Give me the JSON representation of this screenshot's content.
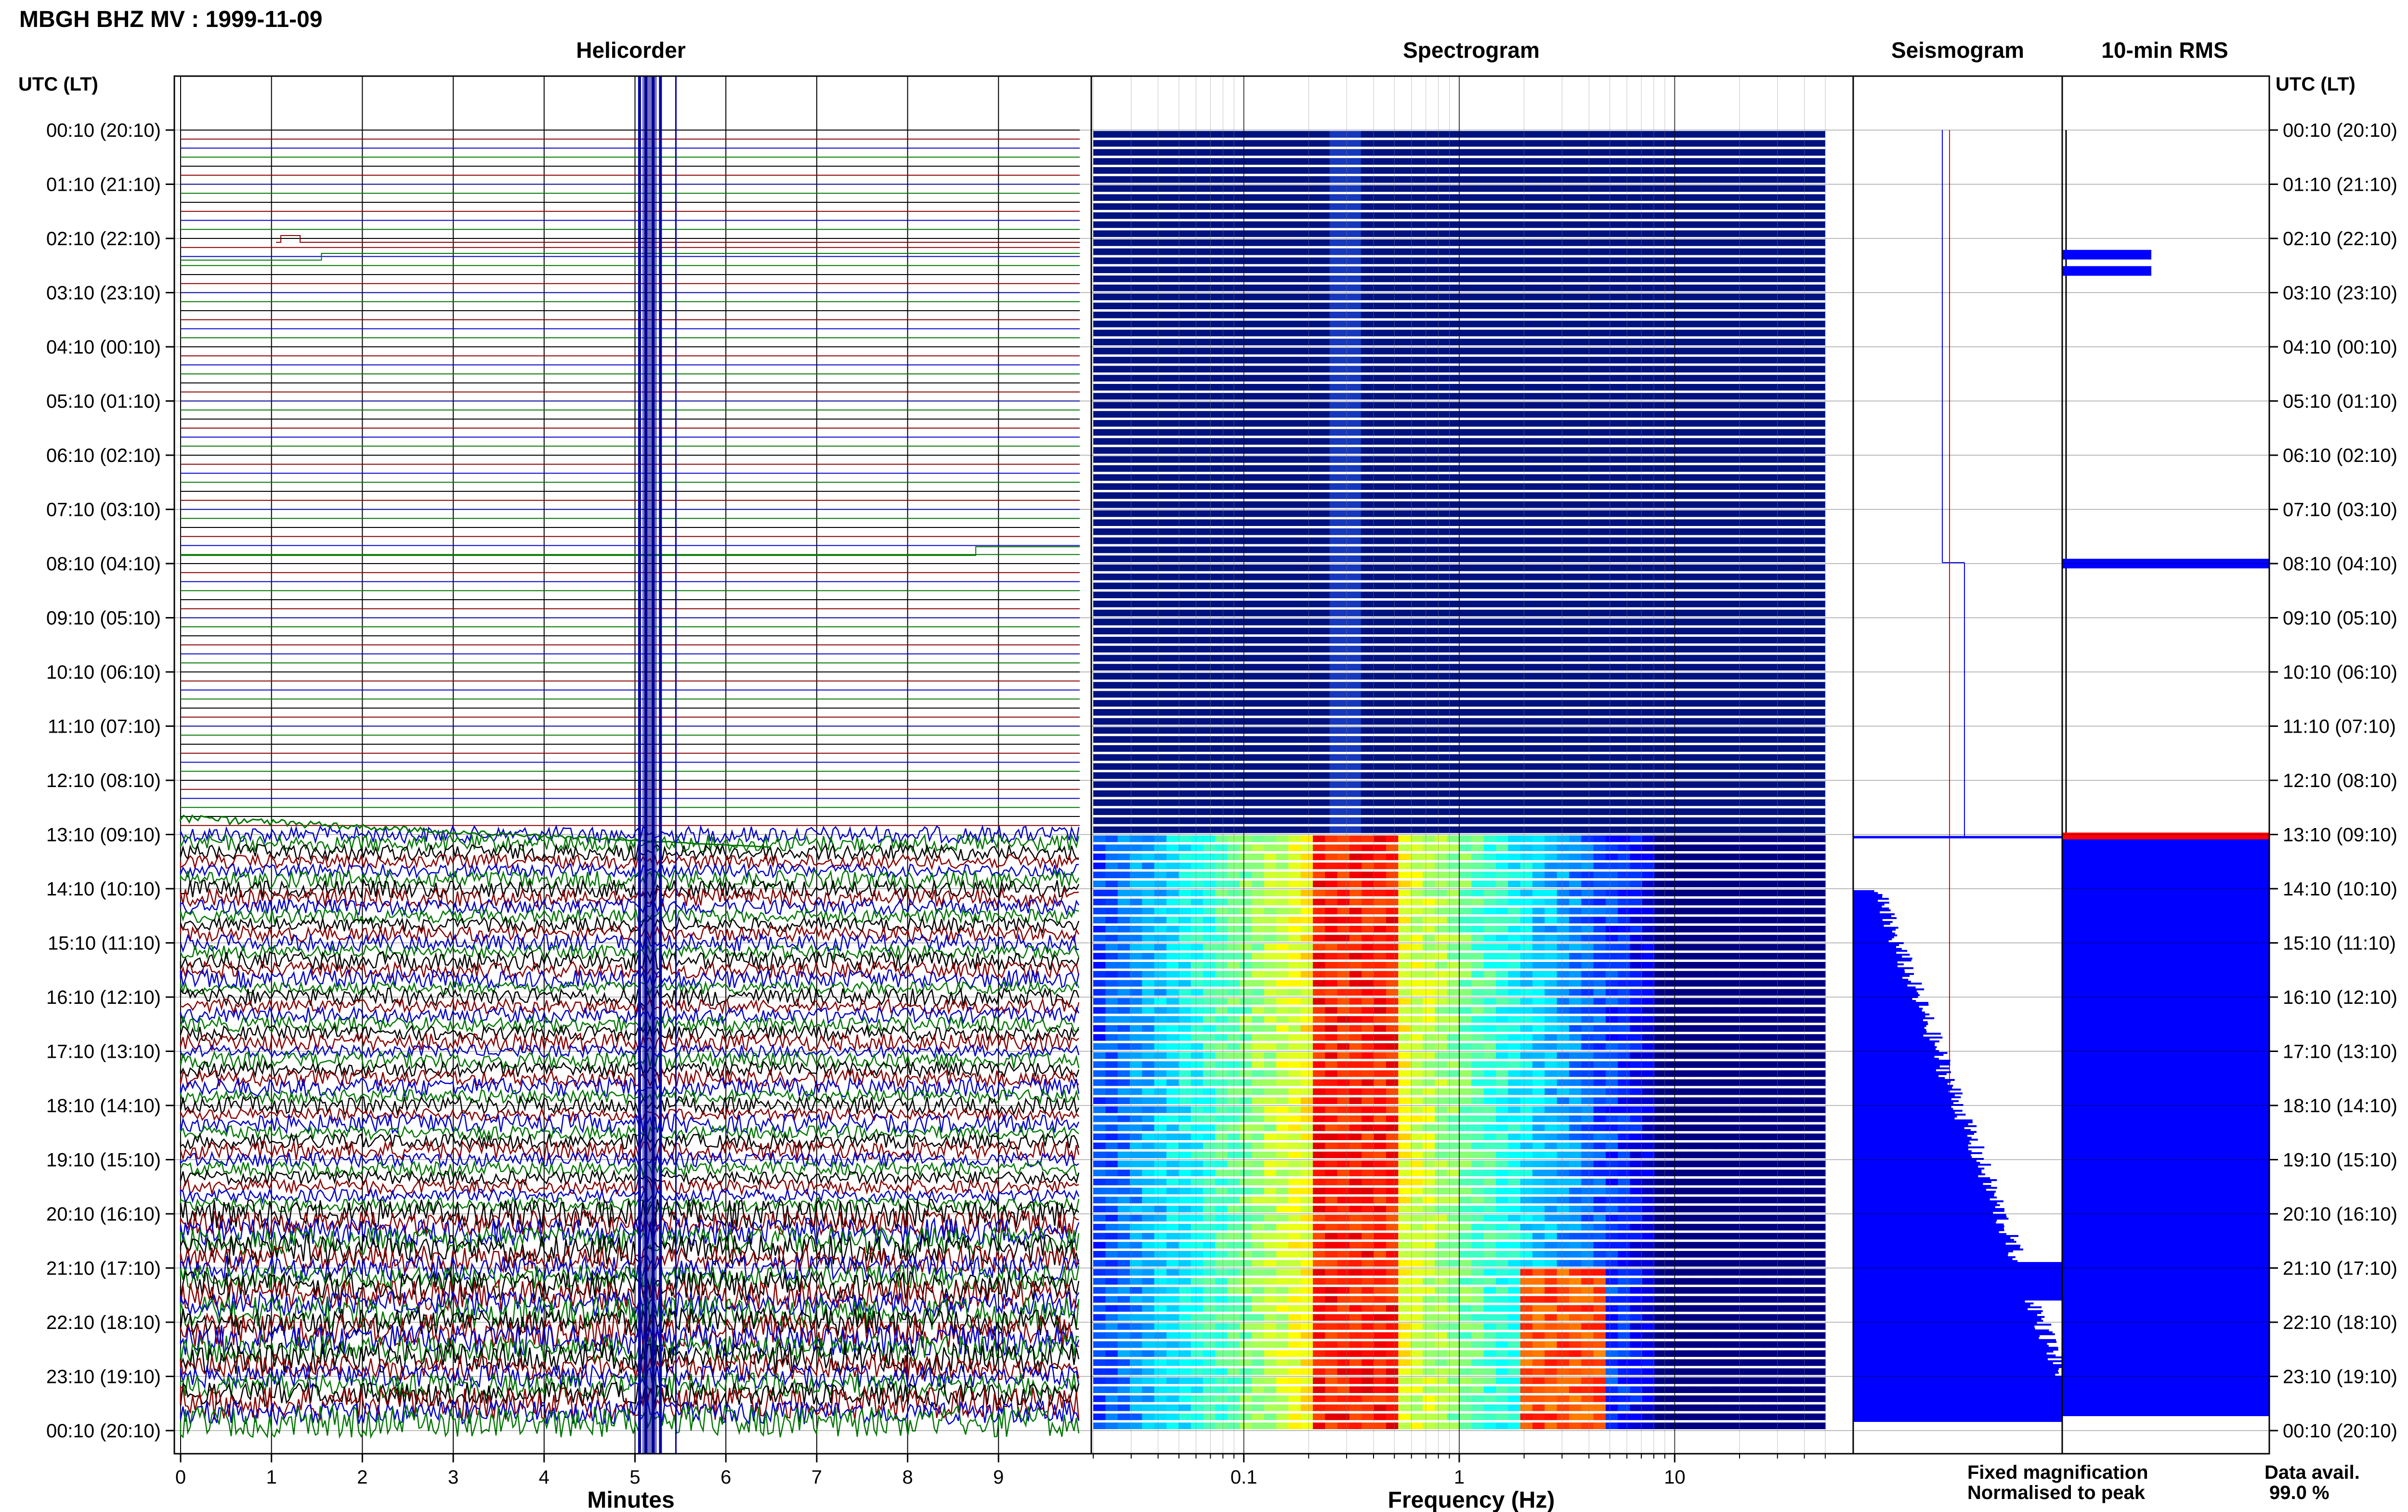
{
  "header": {
    "title": "MBGH BHZ MV : 1999-11-09"
  },
  "panels": {
    "helicorder": "Helicorder",
    "spectrogram": "Spectrogram",
    "seismogram": "Seismogram",
    "rms": "10-min RMS"
  },
  "axes": {
    "left_label": "UTC (LT)",
    "right_label": "UTC (LT)",
    "x_helicorder": "Minutes",
    "x_spectrogram": "Frequency (Hz)"
  },
  "legend": {
    "fixed": "Fixed magnification",
    "normalised": "Normalised to peak",
    "data_avail_label": "Data avail.",
    "data_avail_value": "99.0 %"
  },
  "colors": {
    "fixed": "#0000ff",
    "normalised": "#ff0000",
    "trace": [
      "#000000",
      "#8b0000",
      "#0000cc",
      "#007700"
    ],
    "spec_quiet": "#00127f"
  },
  "chart_data": [
    {
      "type": "line",
      "name": "helicorder",
      "title": "Helicorder",
      "xlabel": "Minutes",
      "xlim": [
        0,
        10
      ],
      "x_ticks": [
        0,
        1,
        2,
        3,
        4,
        5,
        6,
        7,
        8,
        9
      ],
      "y_ticks": [
        "00:10 (20:10)",
        "01:10 (21:10)",
        "02:10 (22:10)",
        "03:10 (23:10)",
        "04:10 (00:10)",
        "05:10 (01:10)",
        "06:10 (02:10)",
        "07:10 (03:10)",
        "08:10 (04:10)",
        "09:10 (05:10)",
        "10:10 (06:10)",
        "11:10 (07:10)",
        "12:10 (08:10)",
        "13:10 (09:10)",
        "14:10 (10:10)",
        "15:10 (11:10)",
        "16:10 (12:10)",
        "17:10 (13:10)",
        "18:10 (14:10)",
        "19:10 (15:10)",
        "20:10 (16:10)",
        "21:10 (17:10)",
        "22:10 (18:10)",
        "23:10 (19:10)",
        "00:10 (20:10)"
      ],
      "rows_per_hour": 6,
      "quiet_until_hour": 13,
      "noisy_from_hour": 13
    },
    {
      "type": "heatmap",
      "name": "spectrogram",
      "title": "Spectrogram",
      "xlabel": "Frequency (Hz)",
      "x_scale": "log",
      "xlim": [
        0.02,
        50
      ],
      "x_tick_labels": [
        "0.1",
        "1",
        "10"
      ],
      "x_tick_values": [
        0.1,
        1,
        10
      ],
      "quiet_until_hour": 13,
      "peak_band_hz": [
        0.2,
        0.5
      ],
      "secondary_peak_band_hz": [
        2,
        5
      ],
      "secondary_from_hour": 21
    },
    {
      "type": "line",
      "name": "seismogram",
      "title": "Seismogram",
      "series": [
        {
          "name": "Fixed magnification"
        },
        {
          "name": "Normalised to peak"
        }
      ]
    },
    {
      "type": "bar",
      "name": "rms",
      "title": "10-min RMS",
      "orientation": "horizontal",
      "quiet_until_hour": 13,
      "spikes_hours": [
        2.3,
        2.6,
        8.0
      ]
    }
  ]
}
